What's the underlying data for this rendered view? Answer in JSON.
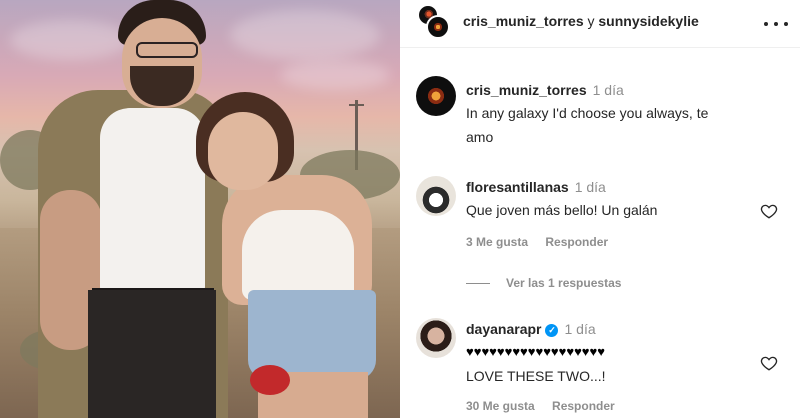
{
  "header": {
    "user1": "cris_muniz_torres",
    "conjunction": "y",
    "user2": "sunnysidekylie"
  },
  "caption": {
    "username": "cris_muniz_torres",
    "time": "1 día",
    "text_line1": "In any galaxy I'd choose you always, te",
    "text_line2": "amo"
  },
  "comments": [
    {
      "username": "floresantillanas",
      "time": "1 día",
      "text": "Que joven más bello! Un galán",
      "likes": "3 Me gusta",
      "reply_label": "Responder"
    },
    {
      "username": "dayanarapr",
      "verified_glyph": "✓",
      "time": "1 día",
      "text_line1": "♥♥♥♥♥♥♥♥♥♥♥♥♥♥♥♥♥♥",
      "text_line2": "LOVE THESE TWO...!",
      "likes": "30 Me gusta",
      "reply_label": "Responder"
    }
  ],
  "view_replies": "Ver las 1 respuestas",
  "icons": {
    "more": "more-options-icon",
    "heart": "heart-outline-icon",
    "verified": "verified-badge-icon"
  }
}
